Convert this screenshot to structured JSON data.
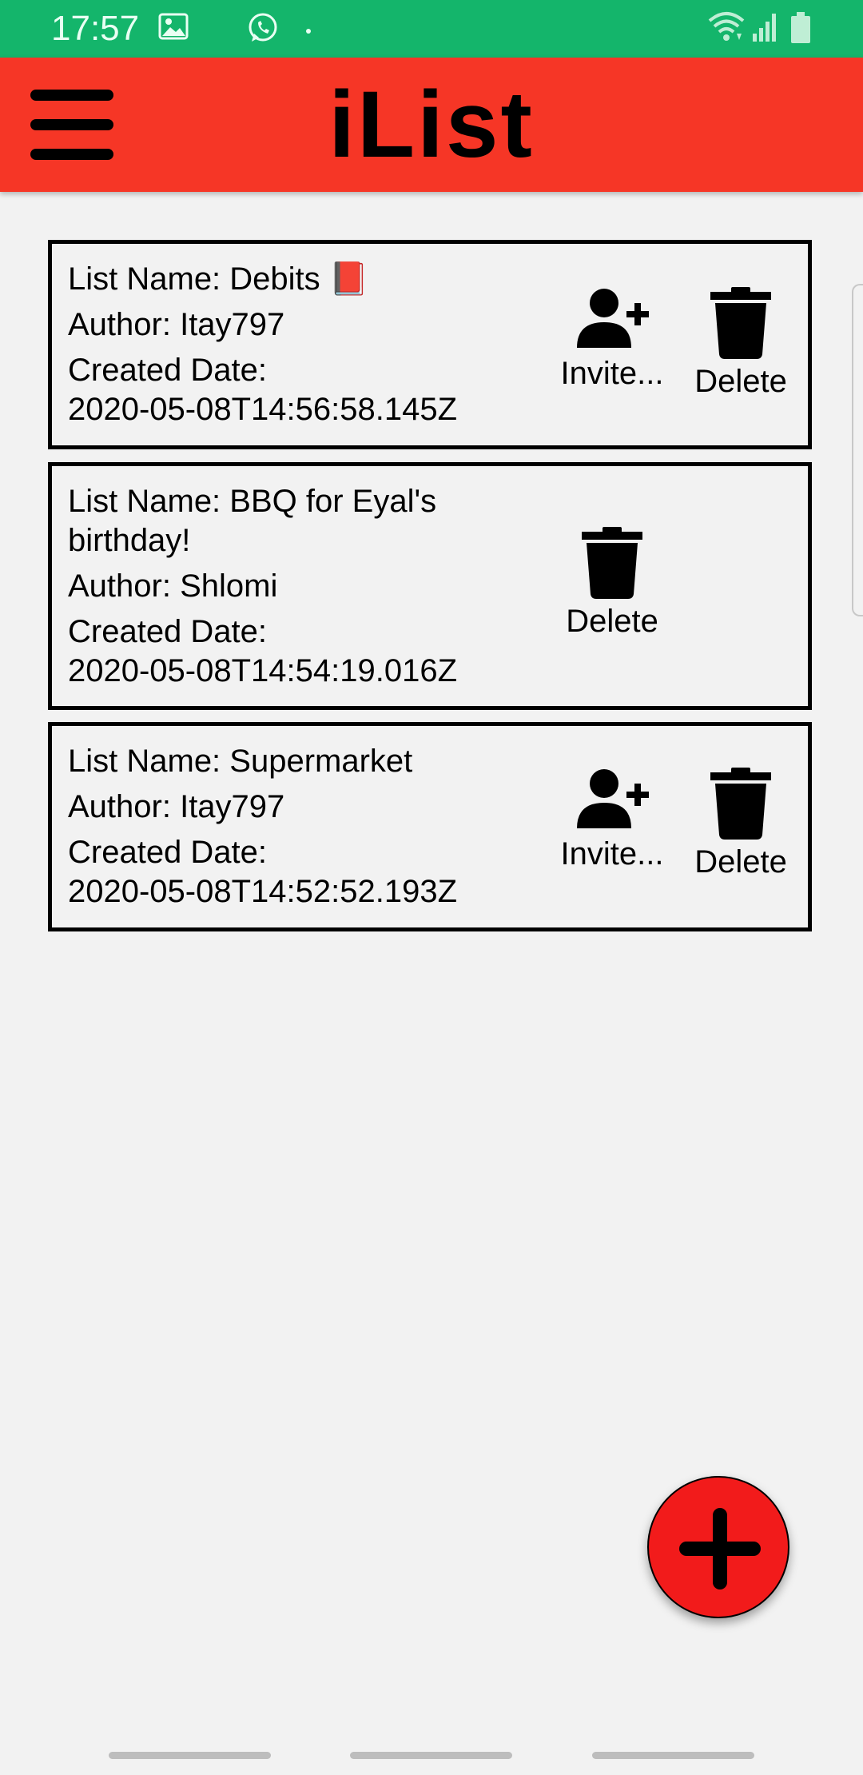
{
  "status_bar": {
    "time": "17:57",
    "background": "#14b56b",
    "icons": [
      "gallery-icon",
      "whatsapp-icon",
      "notification-dot-icon",
      "wifi-icon",
      "signal-icon",
      "battery-icon"
    ]
  },
  "app_bar": {
    "title": "iList",
    "menu_icon": "hamburger-menu-icon",
    "background": "#f63626"
  },
  "lists": [
    {
      "name_line": "List Name: Debits 📕",
      "author_line": "Author: Itay797",
      "created_label": "Created Date:",
      "created_value": "2020-05-08T14:56:58.145Z",
      "invite_label": "Invite...",
      "delete_label": "Delete"
    },
    {
      "name_line": "List Name: BBQ for Eyal's birthday!",
      "author_line": "Author: Shlomi",
      "created_label": "Created Date:",
      "created_value": "2020-05-08T14:54:19.016Z",
      "delete_label": "Delete"
    },
    {
      "name_line": "List Name: Supermarket",
      "author_line": "Author: Itay797",
      "created_label": "Created Date:",
      "created_value": "2020-05-08T14:52:52.193Z",
      "invite_label": "Invite...",
      "delete_label": "Delete"
    }
  ],
  "fab": {
    "icon": "plus-icon",
    "color": "#f21b1b"
  }
}
